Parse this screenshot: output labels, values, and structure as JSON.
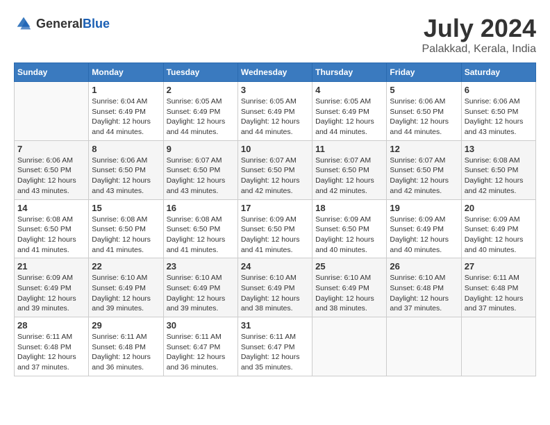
{
  "header": {
    "logo_general": "General",
    "logo_blue": "Blue",
    "month_year": "July 2024",
    "location": "Palakkad, Kerala, India"
  },
  "days_of_week": [
    "Sunday",
    "Monday",
    "Tuesday",
    "Wednesday",
    "Thursday",
    "Friday",
    "Saturday"
  ],
  "weeks": [
    [
      {
        "day": "",
        "sunrise": "",
        "sunset": "",
        "daylight": "",
        "empty": true
      },
      {
        "day": "1",
        "sunrise": "Sunrise: 6:04 AM",
        "sunset": "Sunset: 6:49 PM",
        "daylight": "Daylight: 12 hours and 44 minutes."
      },
      {
        "day": "2",
        "sunrise": "Sunrise: 6:05 AM",
        "sunset": "Sunset: 6:49 PM",
        "daylight": "Daylight: 12 hours and 44 minutes."
      },
      {
        "day": "3",
        "sunrise": "Sunrise: 6:05 AM",
        "sunset": "Sunset: 6:49 PM",
        "daylight": "Daylight: 12 hours and 44 minutes."
      },
      {
        "day": "4",
        "sunrise": "Sunrise: 6:05 AM",
        "sunset": "Sunset: 6:49 PM",
        "daylight": "Daylight: 12 hours and 44 minutes."
      },
      {
        "day": "5",
        "sunrise": "Sunrise: 6:06 AM",
        "sunset": "Sunset: 6:50 PM",
        "daylight": "Daylight: 12 hours and 44 minutes."
      },
      {
        "day": "6",
        "sunrise": "Sunrise: 6:06 AM",
        "sunset": "Sunset: 6:50 PM",
        "daylight": "Daylight: 12 hours and 43 minutes."
      }
    ],
    [
      {
        "day": "7",
        "sunrise": "Sunrise: 6:06 AM",
        "sunset": "Sunset: 6:50 PM",
        "daylight": "Daylight: 12 hours and 43 minutes."
      },
      {
        "day": "8",
        "sunrise": "Sunrise: 6:06 AM",
        "sunset": "Sunset: 6:50 PM",
        "daylight": "Daylight: 12 hours and 43 minutes."
      },
      {
        "day": "9",
        "sunrise": "Sunrise: 6:07 AM",
        "sunset": "Sunset: 6:50 PM",
        "daylight": "Daylight: 12 hours and 43 minutes."
      },
      {
        "day": "10",
        "sunrise": "Sunrise: 6:07 AM",
        "sunset": "Sunset: 6:50 PM",
        "daylight": "Daylight: 12 hours and 42 minutes."
      },
      {
        "day": "11",
        "sunrise": "Sunrise: 6:07 AM",
        "sunset": "Sunset: 6:50 PM",
        "daylight": "Daylight: 12 hours and 42 minutes."
      },
      {
        "day": "12",
        "sunrise": "Sunrise: 6:07 AM",
        "sunset": "Sunset: 6:50 PM",
        "daylight": "Daylight: 12 hours and 42 minutes."
      },
      {
        "day": "13",
        "sunrise": "Sunrise: 6:08 AM",
        "sunset": "Sunset: 6:50 PM",
        "daylight": "Daylight: 12 hours and 42 minutes."
      }
    ],
    [
      {
        "day": "14",
        "sunrise": "Sunrise: 6:08 AM",
        "sunset": "Sunset: 6:50 PM",
        "daylight": "Daylight: 12 hours and 41 minutes."
      },
      {
        "day": "15",
        "sunrise": "Sunrise: 6:08 AM",
        "sunset": "Sunset: 6:50 PM",
        "daylight": "Daylight: 12 hours and 41 minutes."
      },
      {
        "day": "16",
        "sunrise": "Sunrise: 6:08 AM",
        "sunset": "Sunset: 6:50 PM",
        "daylight": "Daylight: 12 hours and 41 minutes."
      },
      {
        "day": "17",
        "sunrise": "Sunrise: 6:09 AM",
        "sunset": "Sunset: 6:50 PM",
        "daylight": "Daylight: 12 hours and 41 minutes."
      },
      {
        "day": "18",
        "sunrise": "Sunrise: 6:09 AM",
        "sunset": "Sunset: 6:50 PM",
        "daylight": "Daylight: 12 hours and 40 minutes."
      },
      {
        "day": "19",
        "sunrise": "Sunrise: 6:09 AM",
        "sunset": "Sunset: 6:49 PM",
        "daylight": "Daylight: 12 hours and 40 minutes."
      },
      {
        "day": "20",
        "sunrise": "Sunrise: 6:09 AM",
        "sunset": "Sunset: 6:49 PM",
        "daylight": "Daylight: 12 hours and 40 minutes."
      }
    ],
    [
      {
        "day": "21",
        "sunrise": "Sunrise: 6:09 AM",
        "sunset": "Sunset: 6:49 PM",
        "daylight": "Daylight: 12 hours and 39 minutes."
      },
      {
        "day": "22",
        "sunrise": "Sunrise: 6:10 AM",
        "sunset": "Sunset: 6:49 PM",
        "daylight": "Daylight: 12 hours and 39 minutes."
      },
      {
        "day": "23",
        "sunrise": "Sunrise: 6:10 AM",
        "sunset": "Sunset: 6:49 PM",
        "daylight": "Daylight: 12 hours and 39 minutes."
      },
      {
        "day": "24",
        "sunrise": "Sunrise: 6:10 AM",
        "sunset": "Sunset: 6:49 PM",
        "daylight": "Daylight: 12 hours and 38 minutes."
      },
      {
        "day": "25",
        "sunrise": "Sunrise: 6:10 AM",
        "sunset": "Sunset: 6:49 PM",
        "daylight": "Daylight: 12 hours and 38 minutes."
      },
      {
        "day": "26",
        "sunrise": "Sunrise: 6:10 AM",
        "sunset": "Sunset: 6:48 PM",
        "daylight": "Daylight: 12 hours and 37 minutes."
      },
      {
        "day": "27",
        "sunrise": "Sunrise: 6:11 AM",
        "sunset": "Sunset: 6:48 PM",
        "daylight": "Daylight: 12 hours and 37 minutes."
      }
    ],
    [
      {
        "day": "28",
        "sunrise": "Sunrise: 6:11 AM",
        "sunset": "Sunset: 6:48 PM",
        "daylight": "Daylight: 12 hours and 37 minutes."
      },
      {
        "day": "29",
        "sunrise": "Sunrise: 6:11 AM",
        "sunset": "Sunset: 6:48 PM",
        "daylight": "Daylight: 12 hours and 36 minutes."
      },
      {
        "day": "30",
        "sunrise": "Sunrise: 6:11 AM",
        "sunset": "Sunset: 6:47 PM",
        "daylight": "Daylight: 12 hours and 36 minutes."
      },
      {
        "day": "31",
        "sunrise": "Sunrise: 6:11 AM",
        "sunset": "Sunset: 6:47 PM",
        "daylight": "Daylight: 12 hours and 35 minutes."
      },
      {
        "day": "",
        "sunrise": "",
        "sunset": "",
        "daylight": "",
        "empty": true
      },
      {
        "day": "",
        "sunrise": "",
        "sunset": "",
        "daylight": "",
        "empty": true
      },
      {
        "day": "",
        "sunrise": "",
        "sunset": "",
        "daylight": "",
        "empty": true
      }
    ]
  ]
}
